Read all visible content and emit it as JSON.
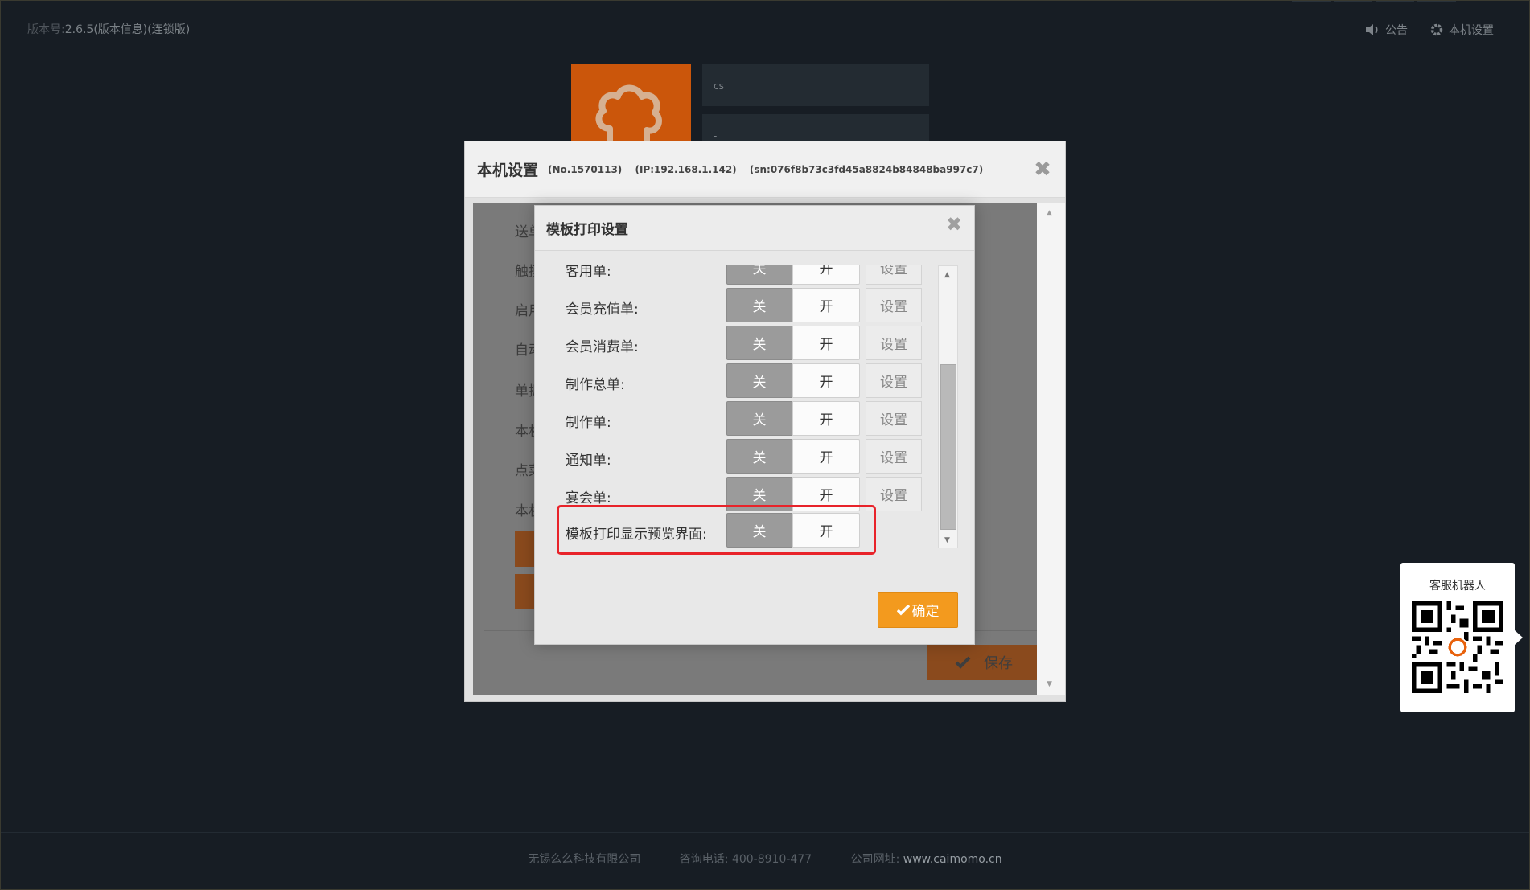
{
  "topbar": {
    "version_label": "版本号:",
    "version_value": "2.6.5(版本信息)(连锁版)",
    "notice_label": "公告",
    "settings_label": "本机设置"
  },
  "background": {
    "store_input": "cs",
    "second_input": "-"
  },
  "outer_dialog": {
    "title": "本机设置",
    "no": "(No.1570113)",
    "ip": "(IP:192.168.1.142)",
    "sn": "(sn:076f8b73c3fd45a8824b84848ba997c7)",
    "truncated_labels": [
      "送单",
      "触摸",
      "启用",
      "自动",
      "单据",
      "本机",
      "点菜",
      "本机"
    ],
    "save_label": "保存"
  },
  "inner_dialog": {
    "title": "模板打印设置",
    "rows": [
      {
        "label": "客用单:",
        "off": "关",
        "on": "开",
        "setting": "设置"
      },
      {
        "label": "会员充值单:",
        "off": "关",
        "on": "开",
        "setting": "设置"
      },
      {
        "label": "会员消费单:",
        "off": "关",
        "on": "开",
        "setting": "设置"
      },
      {
        "label": "制作总单:",
        "off": "关",
        "on": "开",
        "setting": "设置"
      },
      {
        "label": "制作单:",
        "off": "关",
        "on": "开",
        "setting": "设置"
      },
      {
        "label": "通知单:",
        "off": "关",
        "on": "开",
        "setting": "设置"
      },
      {
        "label": "宴会单:",
        "off": "关",
        "on": "开",
        "setting": "设置"
      },
      {
        "label": "模板打印显示预览界面:",
        "off": "关",
        "on": "开"
      }
    ],
    "confirm_label": "确定"
  },
  "service": {
    "caption": "客服机器人"
  },
  "footer": {
    "company": "无锡么么科技有限公司",
    "phone": "咨询电话: 400-8910-477",
    "site_label": "公司网址:",
    "site_url": "www.caimomo.cn"
  },
  "colors": {
    "background": "#1b222a",
    "accent_orange": "#e8620d",
    "confirm_orange": "#f39a1e",
    "highlight_red": "#e8232a"
  }
}
